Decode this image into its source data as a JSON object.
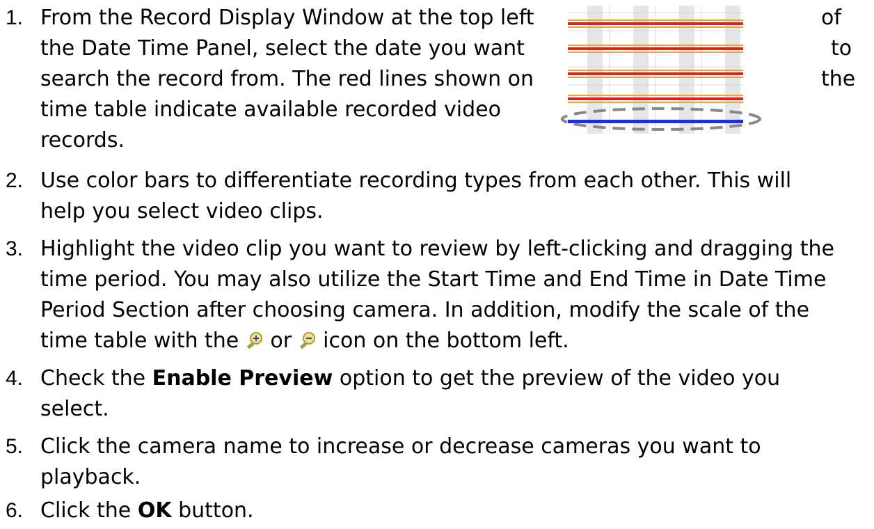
{
  "steps": [
    {
      "number": "1.",
      "lines": [
        "From the Record Display Window at the top left",
        "the Date Time Panel, select the date you want",
        "search the record from. The red lines shown on",
        "time table indicate available recorded video",
        "records."
      ],
      "right_words": [
        "of",
        "to",
        "the"
      ]
    },
    {
      "number": "2.",
      "lines": [
        "Use color bars to differentiate recording types from each other. This will",
        "help you select video clips."
      ]
    },
    {
      "number": "3.",
      "lines": [
        "Highlight the video clip you want to review by left-clicking and dragging the",
        "time period. You may also utilize the Start Time and End Time in Date Time",
        "Period Section after choosing camera. In addition, modify the scale of the"
      ],
      "last_line": {
        "before": "time table with the",
        "between": "or",
        "after": "icon on the bottom left.",
        "icon1": "zoom-in-icon",
        "icon2": "zoom-out-icon"
      }
    },
    {
      "number": "4.",
      "pre": "Check the",
      "bold": "Enable Preview",
      "post": "option to get the preview of the video you",
      "cont": "select."
    },
    {
      "number": "5.",
      "lines": [
        "Click the camera name to increase or decrease cameras you want to",
        "playback."
      ]
    },
    {
      "number": "6.",
      "pre": "Click the",
      "bold": "OK",
      "post": "button."
    }
  ],
  "colors": {
    "record_line": "#d9261c",
    "record_line_secondary": "#e8a33a",
    "highlight_line": "#1f2fe0",
    "grid_column": "#e3e3e3",
    "dashed_ellipse": "#888888"
  },
  "icons": [
    "zoom-in-icon",
    "zoom-out-icon"
  ]
}
